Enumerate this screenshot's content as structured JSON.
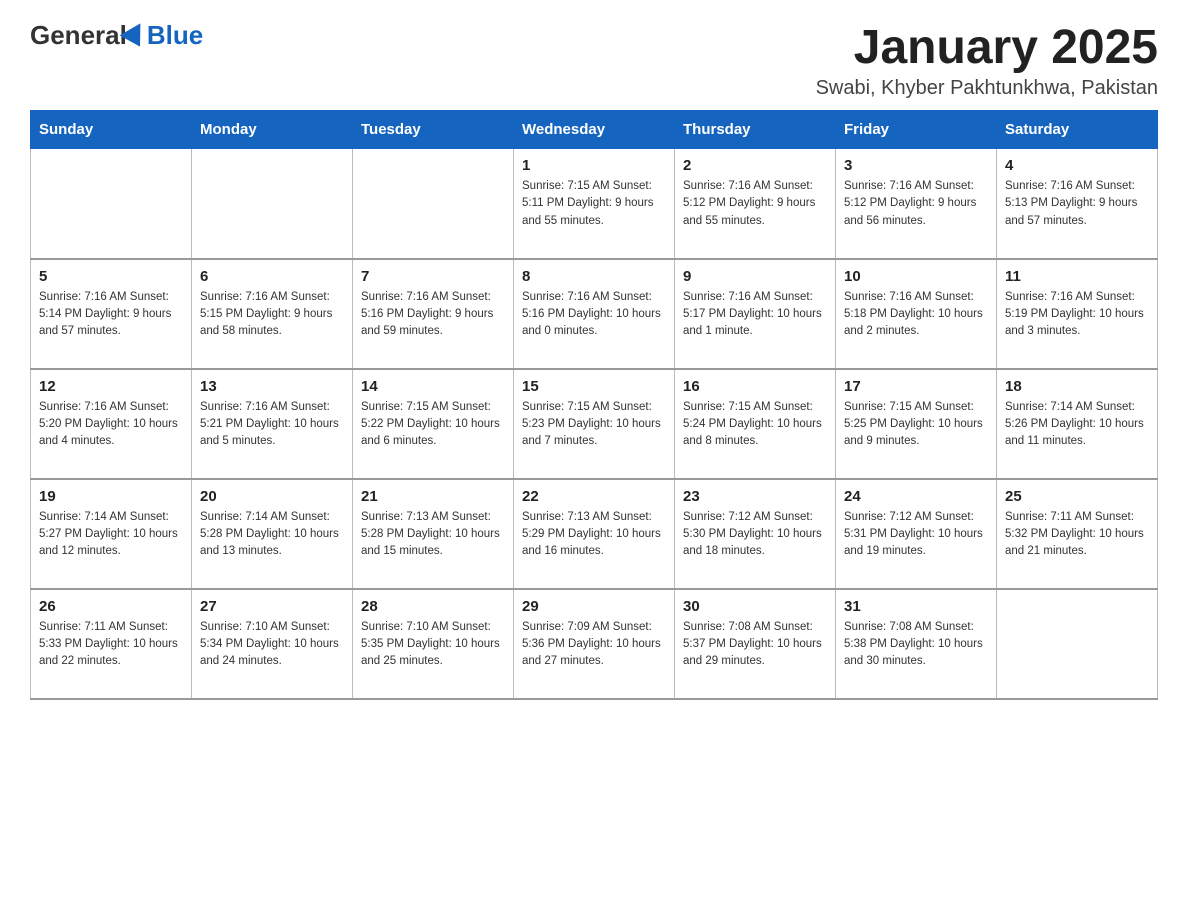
{
  "header": {
    "logo_general": "General",
    "logo_blue": "Blue",
    "month_title": "January 2025",
    "location": "Swabi, Khyber Pakhtunkhwa, Pakistan"
  },
  "weekdays": [
    "Sunday",
    "Monday",
    "Tuesday",
    "Wednesday",
    "Thursday",
    "Friday",
    "Saturday"
  ],
  "weeks": [
    [
      {
        "day": "",
        "info": ""
      },
      {
        "day": "",
        "info": ""
      },
      {
        "day": "",
        "info": ""
      },
      {
        "day": "1",
        "info": "Sunrise: 7:15 AM\nSunset: 5:11 PM\nDaylight: 9 hours\nand 55 minutes."
      },
      {
        "day": "2",
        "info": "Sunrise: 7:16 AM\nSunset: 5:12 PM\nDaylight: 9 hours\nand 55 minutes."
      },
      {
        "day": "3",
        "info": "Sunrise: 7:16 AM\nSunset: 5:12 PM\nDaylight: 9 hours\nand 56 minutes."
      },
      {
        "day": "4",
        "info": "Sunrise: 7:16 AM\nSunset: 5:13 PM\nDaylight: 9 hours\nand 57 minutes."
      }
    ],
    [
      {
        "day": "5",
        "info": "Sunrise: 7:16 AM\nSunset: 5:14 PM\nDaylight: 9 hours\nand 57 minutes."
      },
      {
        "day": "6",
        "info": "Sunrise: 7:16 AM\nSunset: 5:15 PM\nDaylight: 9 hours\nand 58 minutes."
      },
      {
        "day": "7",
        "info": "Sunrise: 7:16 AM\nSunset: 5:16 PM\nDaylight: 9 hours\nand 59 minutes."
      },
      {
        "day": "8",
        "info": "Sunrise: 7:16 AM\nSunset: 5:16 PM\nDaylight: 10 hours\nand 0 minutes."
      },
      {
        "day": "9",
        "info": "Sunrise: 7:16 AM\nSunset: 5:17 PM\nDaylight: 10 hours\nand 1 minute."
      },
      {
        "day": "10",
        "info": "Sunrise: 7:16 AM\nSunset: 5:18 PM\nDaylight: 10 hours\nand 2 minutes."
      },
      {
        "day": "11",
        "info": "Sunrise: 7:16 AM\nSunset: 5:19 PM\nDaylight: 10 hours\nand 3 minutes."
      }
    ],
    [
      {
        "day": "12",
        "info": "Sunrise: 7:16 AM\nSunset: 5:20 PM\nDaylight: 10 hours\nand 4 minutes."
      },
      {
        "day": "13",
        "info": "Sunrise: 7:16 AM\nSunset: 5:21 PM\nDaylight: 10 hours\nand 5 minutes."
      },
      {
        "day": "14",
        "info": "Sunrise: 7:15 AM\nSunset: 5:22 PM\nDaylight: 10 hours\nand 6 minutes."
      },
      {
        "day": "15",
        "info": "Sunrise: 7:15 AM\nSunset: 5:23 PM\nDaylight: 10 hours\nand 7 minutes."
      },
      {
        "day": "16",
        "info": "Sunrise: 7:15 AM\nSunset: 5:24 PM\nDaylight: 10 hours\nand 8 minutes."
      },
      {
        "day": "17",
        "info": "Sunrise: 7:15 AM\nSunset: 5:25 PM\nDaylight: 10 hours\nand 9 minutes."
      },
      {
        "day": "18",
        "info": "Sunrise: 7:14 AM\nSunset: 5:26 PM\nDaylight: 10 hours\nand 11 minutes."
      }
    ],
    [
      {
        "day": "19",
        "info": "Sunrise: 7:14 AM\nSunset: 5:27 PM\nDaylight: 10 hours\nand 12 minutes."
      },
      {
        "day": "20",
        "info": "Sunrise: 7:14 AM\nSunset: 5:28 PM\nDaylight: 10 hours\nand 13 minutes."
      },
      {
        "day": "21",
        "info": "Sunrise: 7:13 AM\nSunset: 5:28 PM\nDaylight: 10 hours\nand 15 minutes."
      },
      {
        "day": "22",
        "info": "Sunrise: 7:13 AM\nSunset: 5:29 PM\nDaylight: 10 hours\nand 16 minutes."
      },
      {
        "day": "23",
        "info": "Sunrise: 7:12 AM\nSunset: 5:30 PM\nDaylight: 10 hours\nand 18 minutes."
      },
      {
        "day": "24",
        "info": "Sunrise: 7:12 AM\nSunset: 5:31 PM\nDaylight: 10 hours\nand 19 minutes."
      },
      {
        "day": "25",
        "info": "Sunrise: 7:11 AM\nSunset: 5:32 PM\nDaylight: 10 hours\nand 21 minutes."
      }
    ],
    [
      {
        "day": "26",
        "info": "Sunrise: 7:11 AM\nSunset: 5:33 PM\nDaylight: 10 hours\nand 22 minutes."
      },
      {
        "day": "27",
        "info": "Sunrise: 7:10 AM\nSunset: 5:34 PM\nDaylight: 10 hours\nand 24 minutes."
      },
      {
        "day": "28",
        "info": "Sunrise: 7:10 AM\nSunset: 5:35 PM\nDaylight: 10 hours\nand 25 minutes."
      },
      {
        "day": "29",
        "info": "Sunrise: 7:09 AM\nSunset: 5:36 PM\nDaylight: 10 hours\nand 27 minutes."
      },
      {
        "day": "30",
        "info": "Sunrise: 7:08 AM\nSunset: 5:37 PM\nDaylight: 10 hours\nand 29 minutes."
      },
      {
        "day": "31",
        "info": "Sunrise: 7:08 AM\nSunset: 5:38 PM\nDaylight: 10 hours\nand 30 minutes."
      },
      {
        "day": "",
        "info": ""
      }
    ]
  ]
}
